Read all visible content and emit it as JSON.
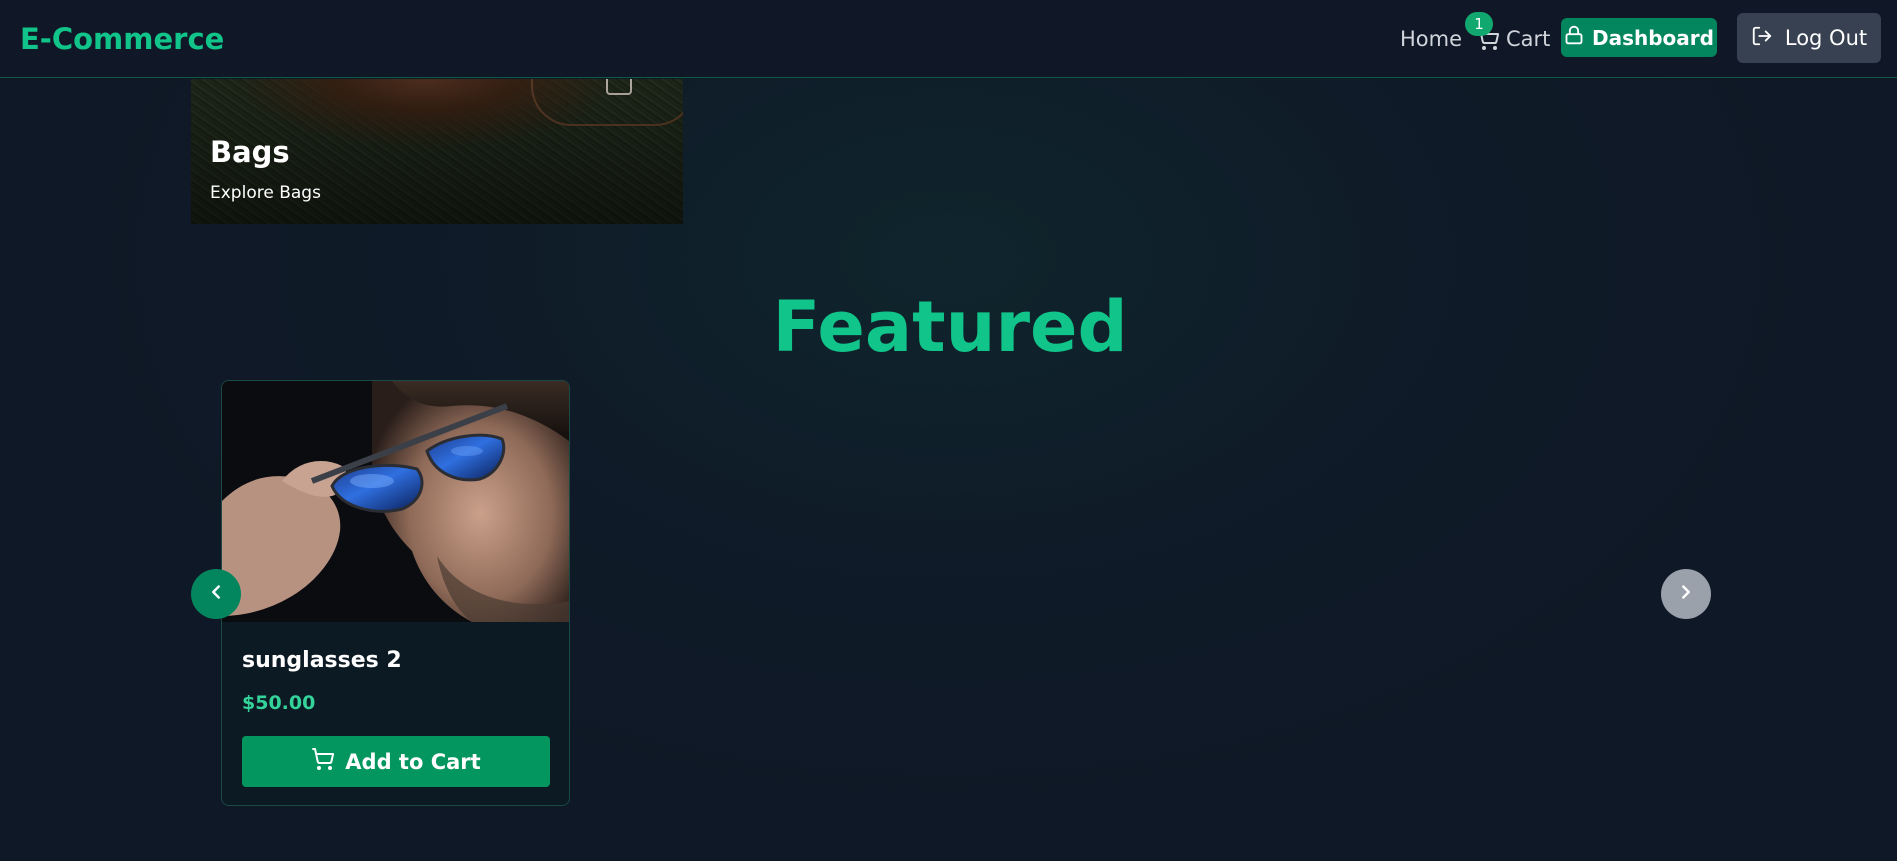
{
  "navbar": {
    "brand": "E-Commerce",
    "home_label": "Home",
    "cart_label": "Cart",
    "cart_count": "1",
    "dashboard_label": "Dashboard",
    "logout_label": "Log Out"
  },
  "category": {
    "title": "Bags",
    "subtitle": "Explore Bags"
  },
  "featured": {
    "heading": "Featured",
    "products": [
      {
        "name": "sunglasses 2",
        "price": "$50.00",
        "add_to_cart_label": "Add to Cart"
      }
    ]
  },
  "colors": {
    "accent": "#10c48a",
    "button_green": "#03865d",
    "background": "#0f1826",
    "logout_bg": "#374151"
  },
  "icons": {
    "cart": "shopping-cart-icon",
    "dashboard": "lock-icon",
    "logout": "log-out-icon",
    "prev": "chevron-left-icon",
    "next": "chevron-right-icon"
  }
}
